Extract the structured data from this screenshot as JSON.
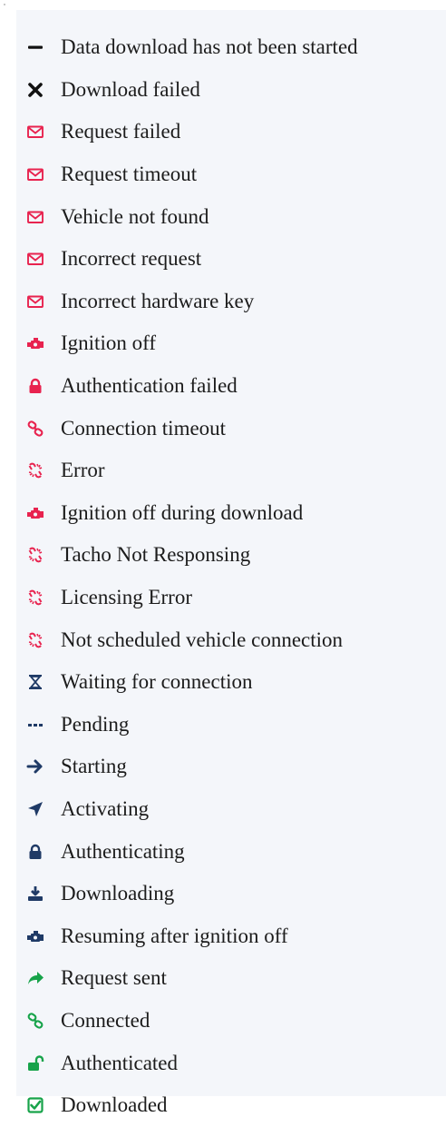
{
  "legend": {
    "items": [
      {
        "label": "Data download has not been started",
        "icon": "minus-icon",
        "color": "#111111"
      },
      {
        "label": "Download failed",
        "icon": "x-icon",
        "color": "#111111"
      },
      {
        "label": "Request failed",
        "icon": "envelope-icon",
        "color": "#e8234f"
      },
      {
        "label": "Request timeout",
        "icon": "envelope-icon",
        "color": "#e8234f"
      },
      {
        "label": "Vehicle not found",
        "icon": "envelope-icon",
        "color": "#e8234f"
      },
      {
        "label": "Incorrect request",
        "icon": "envelope-icon",
        "color": "#e8234f"
      },
      {
        "label": "Incorrect hardware key",
        "icon": "envelope-icon",
        "color": "#e8234f"
      },
      {
        "label": "Ignition off",
        "icon": "engine-icon",
        "color": "#e8234f"
      },
      {
        "label": "Authentication failed",
        "icon": "lock-icon",
        "color": "#e8234f"
      },
      {
        "label": "Connection timeout",
        "icon": "link-icon",
        "color": "#e8234f"
      },
      {
        "label": "Error",
        "icon": "broken-link-icon",
        "color": "#e8234f"
      },
      {
        "label": "Ignition off during download",
        "icon": "engine-icon",
        "color": "#e8234f"
      },
      {
        "label": "Tacho Not Responsing",
        "icon": "broken-link-icon",
        "color": "#e8234f"
      },
      {
        "label": "Licensing Error",
        "icon": "broken-link-icon",
        "color": "#e8234f"
      },
      {
        "label": "Not scheduled vehicle connection",
        "icon": "broken-link-icon",
        "color": "#e8234f"
      },
      {
        "label": "Waiting for connection",
        "icon": "hourglass-icon",
        "color": "#1f3a66"
      },
      {
        "label": "Pending",
        "icon": "ellipsis-icon",
        "color": "#1f3a66"
      },
      {
        "label": "Starting",
        "icon": "arrow-right-icon",
        "color": "#1f3a66"
      },
      {
        "label": "Activating",
        "icon": "location-arrow-icon",
        "color": "#1f3a66"
      },
      {
        "label": "Authenticating",
        "icon": "lock-icon",
        "color": "#1f3a66"
      },
      {
        "label": "Downloading",
        "icon": "download-icon",
        "color": "#1f3a66"
      },
      {
        "label": "Resuming after ignition off",
        "icon": "engine-icon",
        "color": "#1f3a66"
      },
      {
        "label": "Request sent",
        "icon": "share-icon",
        "color": "#17a34a"
      },
      {
        "label": "Connected",
        "icon": "link-icon",
        "color": "#17a34a"
      },
      {
        "label": "Authenticated",
        "icon": "unlock-icon",
        "color": "#17a34a"
      },
      {
        "label": "Downloaded",
        "icon": "check-square-icon",
        "color": "#17a34a"
      }
    ]
  }
}
